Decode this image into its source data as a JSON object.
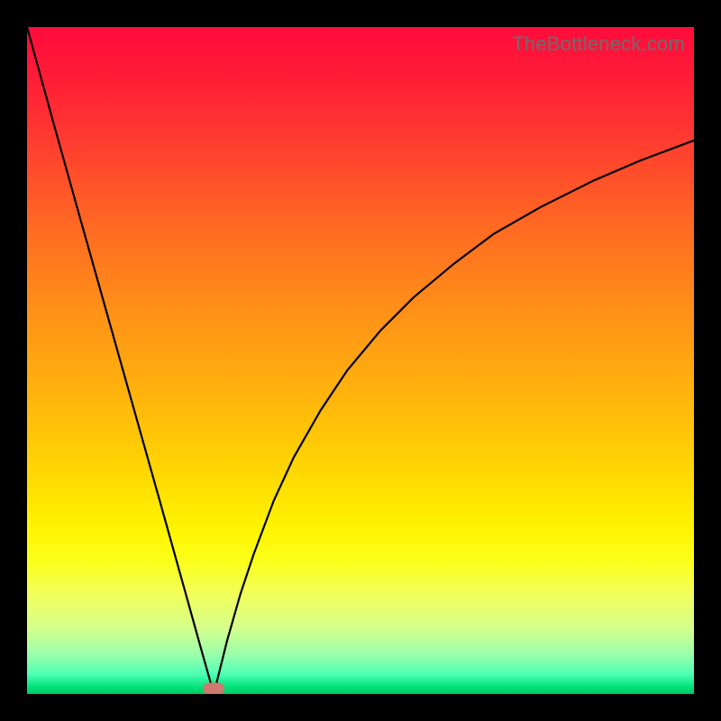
{
  "watermark": "TheBottleneck.com",
  "colors": {
    "frame": "#000000",
    "curve_stroke": "#000000",
    "marker_fill": "#cf7a6e",
    "gradient_top": "#ff0b3c",
    "gradient_bottom": "#00c864"
  },
  "chart_data": {
    "type": "line",
    "title": "",
    "xlabel": "",
    "ylabel": "",
    "xlim": [
      0,
      100
    ],
    "ylim": [
      0,
      100
    ],
    "grid": false,
    "vertex_x": 28,
    "marker": {
      "x": 28,
      "y": 0.8,
      "shape": "pill"
    },
    "series": [
      {
        "name": "left-branch",
        "x": [
          0,
          4,
          8,
          12,
          16,
          20,
          24,
          26,
          27.5,
          28
        ],
        "y": [
          100,
          85.5,
          71.2,
          57.0,
          42.8,
          28.6,
          14.3,
          7.1,
          1.8,
          0
        ]
      },
      {
        "name": "right-branch",
        "x": [
          28,
          29,
          30,
          32,
          34,
          37,
          40,
          44,
          48,
          53,
          58,
          64,
          70,
          77,
          85,
          92,
          100
        ],
        "y": [
          0,
          4.0,
          8.0,
          15.0,
          21.0,
          29.0,
          35.5,
          42.5,
          48.5,
          54.5,
          59.5,
          64.5,
          69.0,
          73.0,
          77.0,
          80.0,
          83.0
        ]
      }
    ]
  }
}
